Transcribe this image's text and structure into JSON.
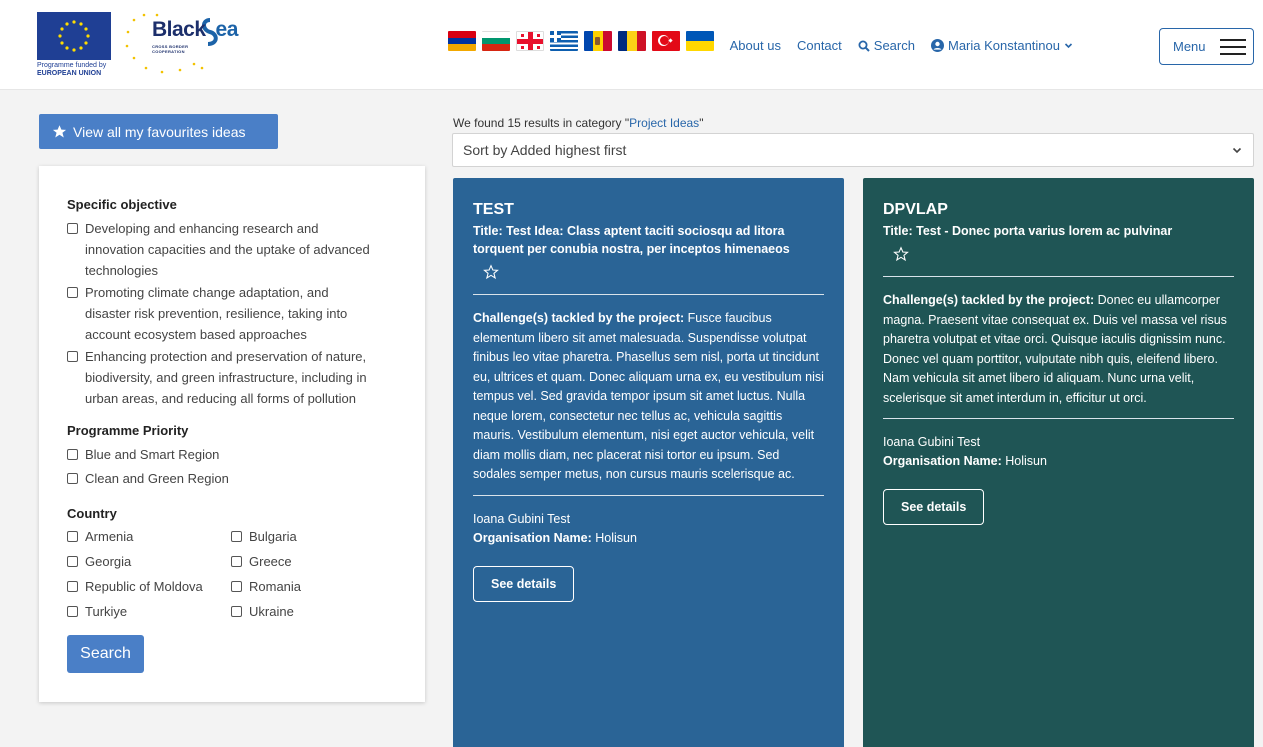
{
  "header": {
    "eu_logo_text": [
      "Programme funded by",
      "EUROPEAN UNION"
    ],
    "bs_logo_title": "Black",
    "bs_logo_title_sea": "ea",
    "bs_logo_sub": [
      "CROSS BORDER",
      "COOPERATION"
    ],
    "flags": [
      "armenia",
      "bulgaria",
      "georgia",
      "greece",
      "moldova",
      "romania",
      "turkiye",
      "ukraine"
    ],
    "nav": {
      "about": "About us",
      "contact": "Contact",
      "search": "Search",
      "user": "Maria Konstantinou"
    },
    "menu_label": "Menu"
  },
  "sidebar": {
    "favourites_label": "View all my favourites ideas",
    "specific_objective": {
      "title": "Specific objective",
      "options": [
        [
          "Developing and enhancing research and",
          "innovation capacities and the uptake of advanced",
          "technologies"
        ],
        [
          "Promoting climate change adaptation, and",
          "disaster risk prevention, resilience, taking into",
          "account ecosystem based approaches"
        ],
        [
          "Enhancing protection and preservation of nature,",
          "biodiversity, and green infrastructure, including in",
          "urban areas, and reducing all forms of pollution"
        ]
      ]
    },
    "programme_priority": {
      "title": "Programme Priority",
      "options": [
        "Blue and Smart Region",
        "Clean and Green Region"
      ]
    },
    "country": {
      "title": "Country",
      "options": [
        "Armenia",
        "Bulgaria",
        "Georgia",
        "Greece",
        "Republic of Moldova",
        "Romania",
        "Turkiye",
        "Ukraine"
      ]
    },
    "search_label": "Search"
  },
  "results": {
    "info_prefix": "We found 15 results in category \"",
    "category": "Project Ideas",
    "info_suffix": "\"",
    "sort_label": "Sort by Added highest first"
  },
  "cards": [
    {
      "acronym": "TEST",
      "title": "Title: Test Idea: Class aptent taciti sociosqu ad litora torquent per conubia nostra, per inceptos himenaeos",
      "challenge_label": "Challenge(s) tackled by the project:",
      "challenge_text": " Fusce faucibus elementum libero sit amet malesuada. Suspendisse volutpat finibus leo vitae pharetra. Phasellus sem nisl, porta ut tincidunt eu, ultrices et quam. Donec aliquam urna ex, eu vestibulum nisi tempus vel. Sed gravida tempor ipsum sit amet luctus. Nulla neque lorem, consectetur nec tellus ac, vehicula sagittis mauris. Vestibulum elementum, nisi eget auctor vehicula, velit diam mollis diam, nec placerat nisi tortor eu ipsum. Sed sodales semper metus, non cursus mauris scelerisque ac.",
      "person": "Ioana Gubini Test",
      "org_label": "Organisation Name:",
      "org_value": " Holisun",
      "see_label": "See details"
    },
    {
      "acronym": "DPVLAP",
      "title": "Title: Test - Donec porta varius lorem ac pulvinar",
      "challenge_label": "Challenge(s) tackled by the project:",
      "challenge_text": " Donec eu ullamcorper magna. Praesent vitae consequat ex. Duis vel massa vel risus pharetra volutpat et vitae orci. Quisque iaculis dignissim nunc. Donec vel quam porttitor, vulputate nibh quis, eleifend libero. Nam vehicula sit amet libero id aliquam. Nunc urna velit, scelerisque sit amet interdum in, efficitur ut orci.",
      "person": "Ioana Gubini Test",
      "org_label": "Organisation Name:",
      "org_value": " Holisun",
      "see_label": "See details"
    }
  ],
  "colors": {
    "brand_blue": "#2866a9",
    "button_blue": "#4a7fc7",
    "card_blue": "#2a6496",
    "card_green": "#1f5555"
  }
}
